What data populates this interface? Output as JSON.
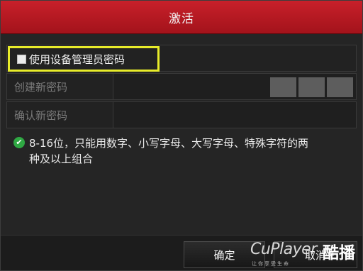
{
  "dialog": {
    "title": "激活"
  },
  "admin_password": {
    "checked": false,
    "label": "使用设备管理员密码"
  },
  "fields": [
    {
      "label": "创建新密码",
      "value": ""
    },
    {
      "label": "确认新密码",
      "value": ""
    }
  ],
  "strength_meter": {
    "segments": 3,
    "level": 0
  },
  "hint": {
    "icon": "check-circle-icon",
    "line1": "8-16位，只能用数字、小写字母、大写字母、特殊字符的两",
    "line2": "种及以上组合"
  },
  "buttons": {
    "ok_label": "确定",
    "cancel_label": "取消"
  },
  "watermark": {
    "main": "CuPlayer",
    "suffix": ".com",
    "sub": "让你享受生命",
    "chinese": "酷播"
  },
  "colors": {
    "title_bar": "#b51a22",
    "highlight": "#e8ec2a",
    "hint_icon": "#2fa843"
  }
}
